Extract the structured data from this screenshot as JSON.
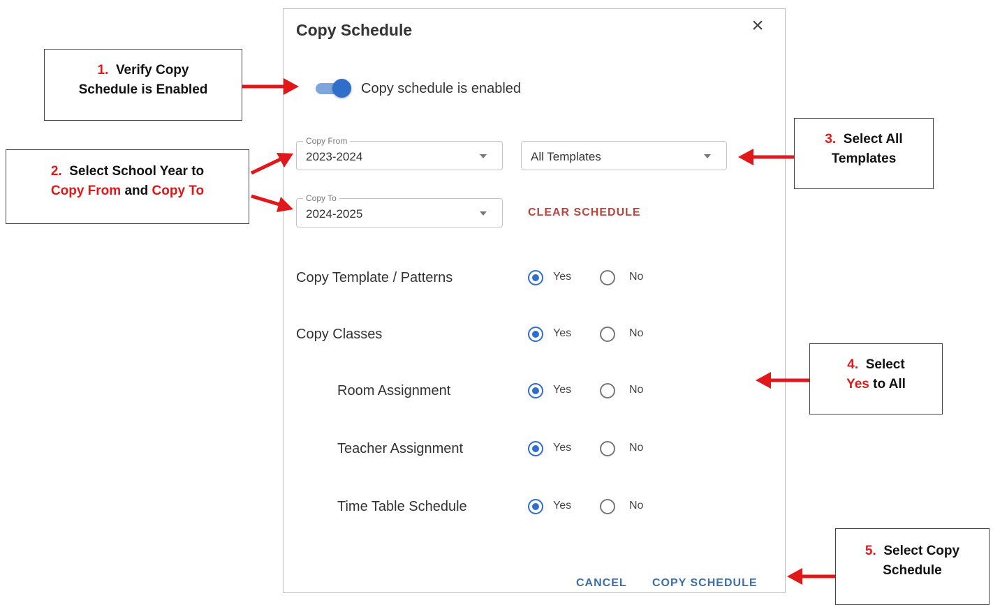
{
  "dialog": {
    "title": "Copy Schedule",
    "close_icon": "×",
    "toggle_label": "Copy schedule is enabled",
    "toggle_on": true,
    "copy_from": {
      "legend": "Copy From",
      "value": "2023-2024"
    },
    "templates": {
      "value": "All Templates"
    },
    "copy_to": {
      "legend": "Copy To",
      "value": "2024-2025"
    },
    "clear_label": "CLEAR SCHEDULE",
    "yes_label": "Yes",
    "no_label": "No",
    "options": [
      {
        "label": "Copy Template / Patterns",
        "selected": "Yes"
      },
      {
        "label": "Copy Classes",
        "selected": "Yes"
      },
      {
        "label": "Room Assignment",
        "selected": "Yes"
      },
      {
        "label": "Teacher Assignment",
        "selected": "Yes"
      },
      {
        "label": "Time Table Schedule",
        "selected": "Yes"
      }
    ],
    "cancel_label": "CANCEL",
    "copy_label": "COPY SCHEDULE",
    "accent_color": "#2f6fcb",
    "clear_color": "#b5453f"
  },
  "annotations": {
    "note1": {
      "num": "1.",
      "line1": "Verify Copy",
      "line2": "Schedule is Enabled"
    },
    "note2": {
      "num": "2.",
      "line1": "Select School Year to",
      "red1": "Copy From",
      "and": "and",
      "red2": "Copy To"
    },
    "note3": {
      "num": "3.",
      "line1": "Select All",
      "line2": "Templates"
    },
    "note4": {
      "num": "4.",
      "line1": "Select",
      "red": "Yes",
      "tail": "to All"
    },
    "note5": {
      "num": "5.",
      "line1": "Select Copy",
      "line2": "Schedule"
    },
    "arrow_color": "#e0181a"
  }
}
